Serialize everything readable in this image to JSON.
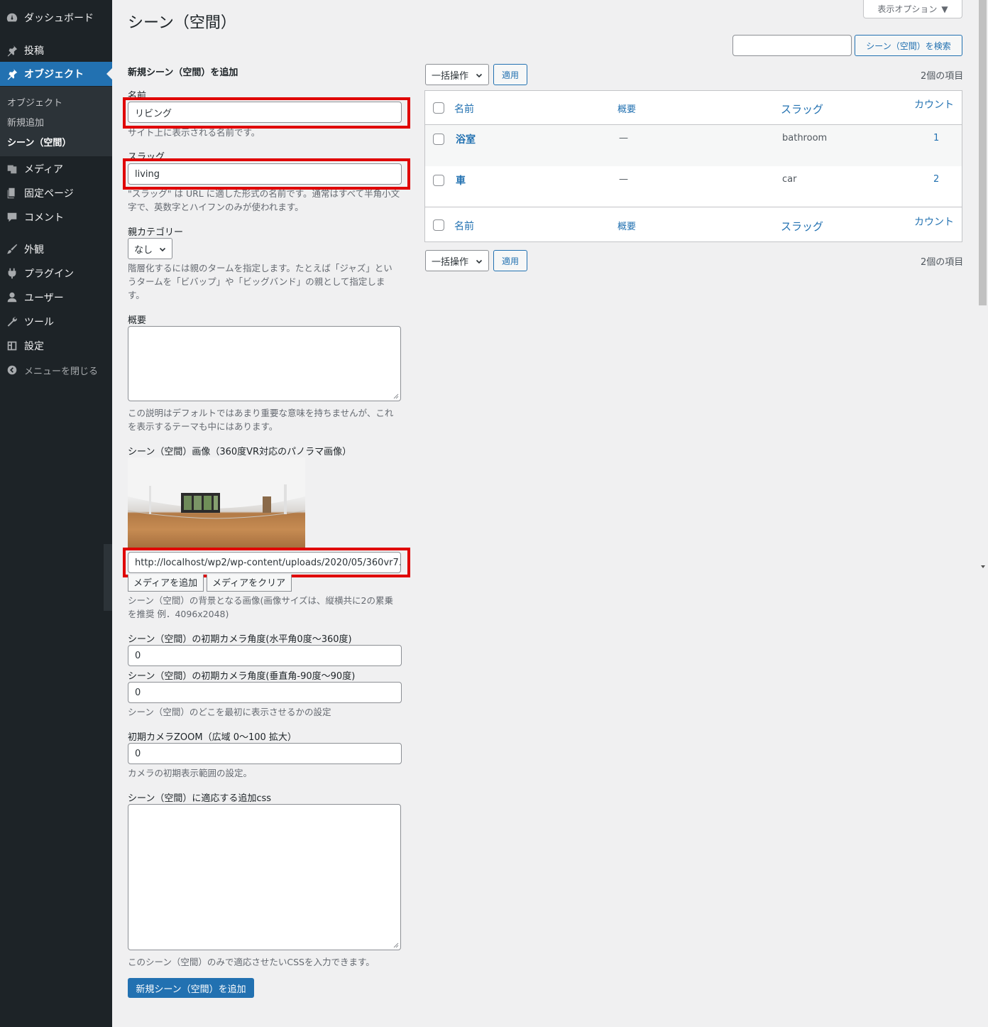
{
  "sidebar": {
    "items": [
      {
        "label": "ダッシュボード",
        "icon": "dashboard-icon"
      },
      {
        "label": "投稿",
        "icon": "pin-icon"
      },
      {
        "label": "オブジェクト",
        "icon": "pin-icon"
      },
      {
        "label": "メディア",
        "icon": "media-icon"
      },
      {
        "label": "固定ページ",
        "icon": "page-icon"
      },
      {
        "label": "コメント",
        "icon": "comment-icon"
      },
      {
        "label": "外観",
        "icon": "brush-icon"
      },
      {
        "label": "プラグイン",
        "icon": "plugin-icon"
      },
      {
        "label": "ユーザー",
        "icon": "user-icon"
      },
      {
        "label": "ツール",
        "icon": "wrench-icon"
      },
      {
        "label": "設定",
        "icon": "settings-icon"
      }
    ],
    "submenu": [
      "オブジェクト",
      "新規追加",
      "シーン（空間）"
    ],
    "collapse_label": "メニューを閉じる",
    "accent_color": "#2271b1"
  },
  "header": {
    "screen_options": "表示オプション",
    "title": "シーン（空間）",
    "search_button": "シーン（空間）を検索"
  },
  "form": {
    "heading": "新規シーン（空間）を追加",
    "name_label": "名前",
    "name_value": "リビング",
    "name_desc": "サイト上に表示される名前です。",
    "slug_label": "スラッグ",
    "slug_value": "living",
    "slug_desc": "\"スラッグ\" は URL に適した形式の名前です。通常はすべて半角小文字で、英数字とハイフンのみが使われます。",
    "parent_label": "親カテゴリー",
    "parent_value": "なし",
    "parent_desc": "階層化するには親のタームを指定します。たとえば「ジャズ」というタームを「ビバップ」や「ビッグバンド」の親として指定します。",
    "description_label": "概要",
    "description_desc": "この説明はデフォルトではあまり重要な意味を持ちませんが、これを表示するテーマも中にはあります。",
    "image_label": "シーン（空間）画像（360度VR対応のパノラマ画像）",
    "image_url": "http://localhost/wp2/wp-content/uploads/2020/05/360vr7.jpg",
    "add_media": "メディアを追加",
    "clear_media": "メディアをクリア",
    "image_desc": "シーン（空間）の背景となる画像(画像サイズは、縦横共に2の累乗を推奨 例．4096x2048)",
    "h_angle_label": "シーン（空間）の初期カメラ角度(水平角0度～360度)",
    "h_angle_value": "0",
    "v_angle_label": "シーン（空間）の初期カメラ角度(垂直角-90度～90度)",
    "v_angle_value": "0",
    "angle_desc": "シーン（空間）のどこを最初に表示させるかの設定",
    "zoom_label": "初期カメラZOOM（広域 0～100 拡大）",
    "zoom_value": "0",
    "zoom_desc": "カメラの初期表示範囲の設定。",
    "css_label": "シーン（空間）に適応する追加css",
    "css_desc": "このシーン（空間）のみで適応させたいCSSを入力できます。",
    "submit": "新規シーン（空間）を追加"
  },
  "table": {
    "bulk_action": "一括操作",
    "apply": "適用",
    "items_count": "2個の項目",
    "columns": [
      "名前",
      "概要",
      "スラッグ",
      "カウント"
    ],
    "rows": [
      {
        "name": "浴室",
        "description": "—",
        "slug": "bathroom",
        "count": "1"
      },
      {
        "name": "車",
        "description": "—",
        "slug": "car",
        "count": "2"
      }
    ]
  },
  "highlight_color": "#e00000"
}
